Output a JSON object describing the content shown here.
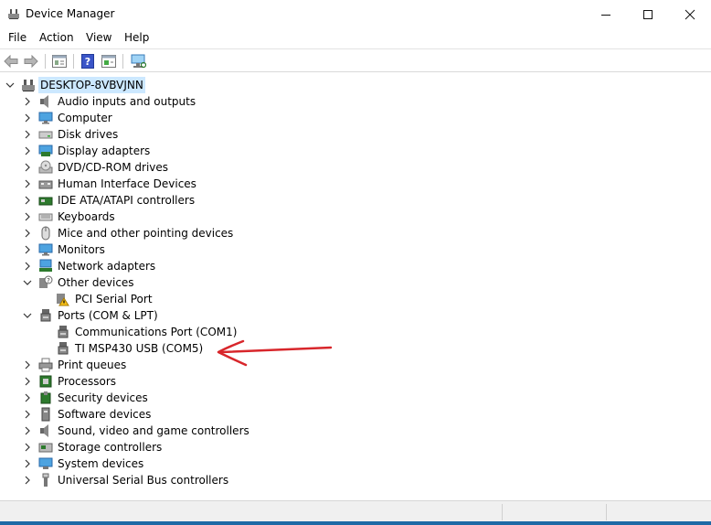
{
  "window": {
    "title": "Device Manager",
    "minimize_icon": "minimize-icon",
    "maximize_icon": "maximize-icon",
    "close_icon": "close-icon"
  },
  "menu": [
    "File",
    "Action",
    "View",
    "Help"
  ],
  "toolbar": {
    "buttons": [
      "back-arrow-icon",
      "forward-arrow-icon",
      "properties-icon",
      "help-icon",
      "update-driver-icon",
      "scan-hardware-icon"
    ]
  },
  "tree": {
    "root": "DESKTOP-8VBVJNN",
    "categories": [
      {
        "label": "Audio inputs and outputs",
        "icon": "speaker-icon",
        "expanded": false,
        "children": []
      },
      {
        "label": "Computer",
        "icon": "monitor-icon",
        "expanded": false,
        "children": []
      },
      {
        "label": "Disk drives",
        "icon": "disk-drive-icon",
        "expanded": false,
        "children": []
      },
      {
        "label": "Display adapters",
        "icon": "display-adapter-icon",
        "expanded": false,
        "children": []
      },
      {
        "label": "DVD/CD-ROM drives",
        "icon": "dvd-drive-icon",
        "expanded": false,
        "children": []
      },
      {
        "label": "Human Interface Devices",
        "icon": "hid-icon",
        "expanded": false,
        "children": []
      },
      {
        "label": "IDE ATA/ATAPI controllers",
        "icon": "ide-controller-icon",
        "expanded": false,
        "children": []
      },
      {
        "label": "Keyboards",
        "icon": "keyboard-icon",
        "expanded": false,
        "children": []
      },
      {
        "label": "Mice and other pointing devices",
        "icon": "mouse-icon",
        "expanded": false,
        "children": []
      },
      {
        "label": "Monitors",
        "icon": "monitor-icon",
        "expanded": false,
        "children": []
      },
      {
        "label": "Network adapters",
        "icon": "network-adapter-icon",
        "expanded": false,
        "children": []
      },
      {
        "label": "Other devices",
        "icon": "unknown-device-icon",
        "expanded": true,
        "children": [
          {
            "label": "PCI Serial Port",
            "icon": "warning-device-icon"
          }
        ]
      },
      {
        "label": "Ports (COM & LPT)",
        "icon": "port-icon",
        "expanded": true,
        "children": [
          {
            "label": "Communications Port (COM1)",
            "icon": "port-icon"
          },
          {
            "label": "TI MSP430 USB (COM5)",
            "icon": "port-icon"
          }
        ]
      },
      {
        "label": "Print queues",
        "icon": "printer-icon",
        "expanded": false,
        "children": []
      },
      {
        "label": "Processors",
        "icon": "processor-icon",
        "expanded": false,
        "children": []
      },
      {
        "label": "Security devices",
        "icon": "security-device-icon",
        "expanded": false,
        "children": []
      },
      {
        "label": "Software devices",
        "icon": "software-device-icon",
        "expanded": false,
        "children": []
      },
      {
        "label": "Sound, video and game controllers",
        "icon": "speaker-icon",
        "expanded": false,
        "children": []
      },
      {
        "label": "Storage controllers",
        "icon": "storage-controller-icon",
        "expanded": false,
        "children": []
      },
      {
        "label": "System devices",
        "icon": "system-device-icon",
        "expanded": false,
        "children": []
      },
      {
        "label": "Universal Serial Bus controllers",
        "icon": "usb-icon",
        "expanded": false,
        "children": []
      }
    ]
  },
  "annotation": {
    "icon": "red-arrow-icon",
    "color": "#d8262b"
  },
  "colors": {
    "selection": "#cce8ff",
    "accent": "#1e6aa6"
  }
}
